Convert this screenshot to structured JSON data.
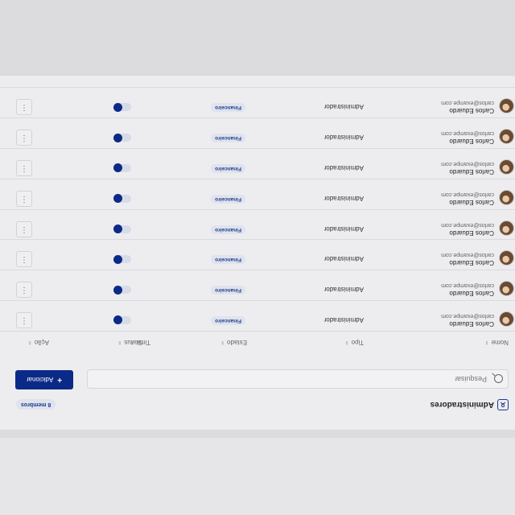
{
  "header": {
    "title": "Administradores",
    "members_badge": "8 membros"
  },
  "toolbar": {
    "search_placeholder": "Pesquisar",
    "add_label": "Adicionar",
    "add_icon": "+"
  },
  "table": {
    "columns": [
      "Nome",
      "Tipo",
      "Estado",
      "Time",
      "Status",
      "Ação"
    ],
    "sort_icon": "⇕",
    "menu_icon": "⋮",
    "rows": [
      {
        "name": "Carlos Eduardo",
        "email": "carlos@exampe.com",
        "tipo": "Administrador",
        "time": "Financeiro",
        "status": "on"
      },
      {
        "name": "Carlos Eduardo",
        "email": "carlos@exampe.com",
        "tipo": "Administrador",
        "time": "Financeiro",
        "status": "on"
      },
      {
        "name": "Carlos Eduardo",
        "email": "carlos@exampe.com",
        "tipo": "Administrador",
        "time": "Financeiro",
        "status": "on"
      },
      {
        "name": "Carlos Eduardo",
        "email": "carlos@exampe.com",
        "tipo": "Administrador",
        "time": "Financeiro",
        "status": "on"
      },
      {
        "name": "Carlos Eduardo",
        "email": "carlos@exampe.com",
        "tipo": "Administrador",
        "time": "Financeiro",
        "status": "on"
      },
      {
        "name": "Carlos Eduardo",
        "email": "carlos@exampe.com",
        "tipo": "Administrador",
        "time": "Financeiro",
        "status": "on"
      },
      {
        "name": "Carlos Eduardo",
        "email": "carlos@exampe.com",
        "tipo": "Administrador",
        "time": "Financeiro",
        "status": "on"
      },
      {
        "name": "Carlos Eduardo",
        "email": "carlos@exampe.com",
        "tipo": "Administrador",
        "time": "Financeiro",
        "status": "on"
      }
    ]
  },
  "colors": {
    "accent": "#0b2a87",
    "pill_bg": "#dfe3ee",
    "card_bg": "#ededef"
  }
}
